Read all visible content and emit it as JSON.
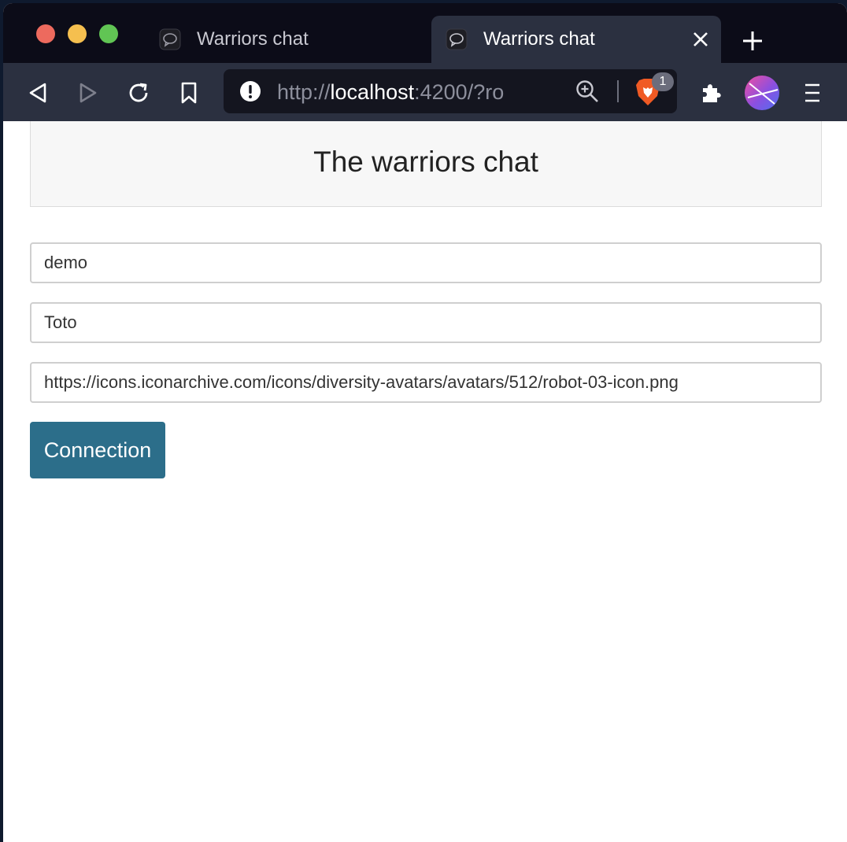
{
  "browser": {
    "tabs": [
      {
        "title": "Warriors chat",
        "active": false
      },
      {
        "title": "Warriors chat",
        "active": true
      }
    ],
    "url": {
      "scheme": "http://",
      "host": "localhost",
      "rest": ":4200/?ro..."
    },
    "shields_badge": "1",
    "colors": {
      "tabstrip": "#0c0c18",
      "toolbar": "#2b3040",
      "urlbar": "#14151f"
    }
  },
  "page": {
    "title": "The warriors chat",
    "fields": [
      {
        "name": "room",
        "value": "demo"
      },
      {
        "name": "username",
        "value": "Toto"
      },
      {
        "name": "avatar_url",
        "value": "https://icons.iconarchive.com/icons/diversity-avatars/avatars/512/robot-03-icon.png"
      }
    ],
    "connect_label": "Connection",
    "colors": {
      "button": "#2c6e8a",
      "header_bg": "#f7f7f7"
    }
  }
}
